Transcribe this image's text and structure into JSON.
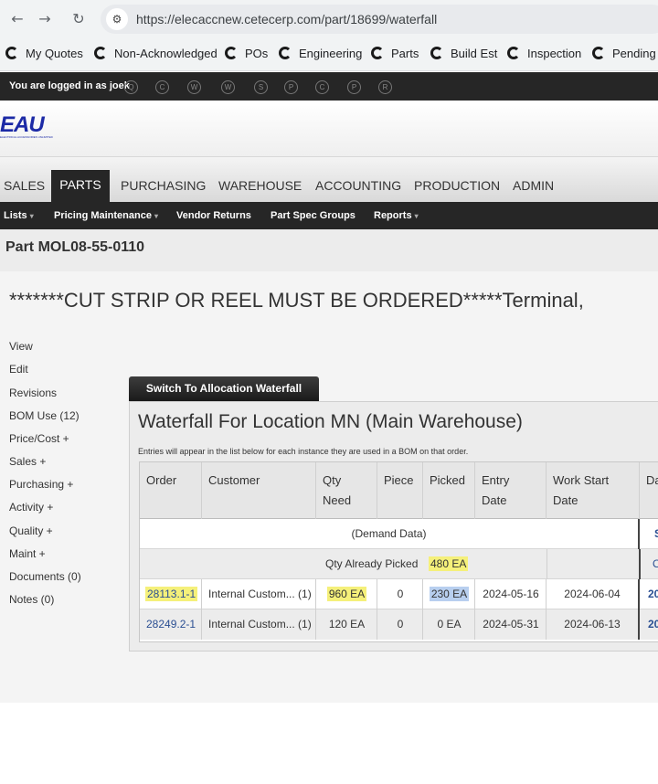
{
  "browser": {
    "url": "https://elecaccnew.cetecerp.com/part/18699/waterfall",
    "bookmarks": [
      "My Quotes",
      "Non-Acknowledged",
      "POs",
      "Engineering",
      "Parts",
      "Build Est",
      "Inspection",
      "Pending S"
    ]
  },
  "login": {
    "text": "You are logged in as joek",
    "icon_letters": [
      "Q",
      "C",
      "W",
      "W",
      "S",
      "P",
      "C",
      "P",
      "R"
    ]
  },
  "logo": {
    "text": "EAU",
    "subtext": "ELECTRICAL ACCESSORIES UNLIMITED"
  },
  "main_nav": {
    "items": [
      "SALES",
      "PARTS",
      "PURCHASING",
      "WAREHOUSE",
      "ACCOUNTING",
      "PRODUCTION",
      "ADMIN"
    ],
    "active": "PARTS"
  },
  "sub_nav": {
    "items": [
      "Lists",
      "Pricing Maintenance",
      "Vendor Returns",
      "Part Spec Groups",
      "Reports"
    ],
    "caret": "▾"
  },
  "part": {
    "title": "Part MOL08-55-0110",
    "notice": "*******CUT STRIP OR REEL MUST BE ORDERED*****Terminal,"
  },
  "sidebar": {
    "links": [
      "View",
      "Edit",
      "Revisions",
      "BOM Use (12)",
      "Price/Cost +",
      "Sales +",
      "Purchasing +",
      "Activity +",
      "Quality +",
      "Maint +",
      "Documents (0)",
      "Notes (0)"
    ]
  },
  "waterfall": {
    "switch_button": "Switch To Allocation Waterfall",
    "title": "Waterfall For Location MN (Main Warehouse)",
    "note": "Entries will appear in the list below for each instance they are used in a BOM on that order.",
    "headers": {
      "order": "Order",
      "customer": "Customer",
      "qty_need_1": "Qty",
      "qty_need_2": "Need",
      "piece": "Piece",
      "picked": "Picked",
      "entry_1": "Entry",
      "entry_2": "Date",
      "work_1": "Work Start",
      "work_2": "Date",
      "next": "Da"
    },
    "demand_label": "(Demand Data)",
    "demand_right": "S",
    "picked_label": "Qty Already Picked",
    "picked_value": "480 EA",
    "picked_right": "O",
    "rows": [
      {
        "order": "28113.1-1",
        "customer": "Internal Custom... (1)",
        "qty": "960 EA",
        "piece": "0",
        "picked": "230 EA",
        "entry": "2024-05-16",
        "work": "2024-06-04",
        "next": "20"
      },
      {
        "order": "28249.2-1",
        "customer": "Internal Custom... (1)",
        "qty": "120 EA",
        "piece": "0",
        "picked": "0 EA",
        "entry": "2024-05-31",
        "work": "2024-06-13",
        "next": "20"
      }
    ]
  }
}
